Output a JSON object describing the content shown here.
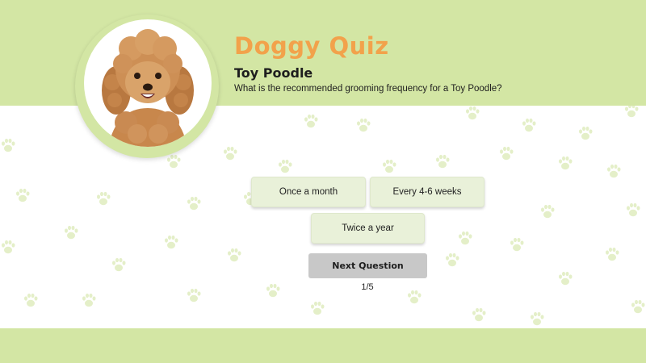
{
  "quiz": {
    "title": "Doggy Quiz",
    "breed": "Toy Poodle",
    "question": "What is the recommended grooming frequency for a Toy Poodle?",
    "answers": [
      "Once a month",
      "Every 4-6 weeks",
      "Twice a year"
    ],
    "next_label": "Next Question",
    "progress": "1/5"
  },
  "image": {
    "subject": "toy-poodle-photo"
  },
  "colors": {
    "band": "#d3e6a4",
    "title": "#f2a24b",
    "answer_bg": "#e9f1d9",
    "next_bg": "#c8c8c8",
    "paw": "#e4efc8"
  }
}
